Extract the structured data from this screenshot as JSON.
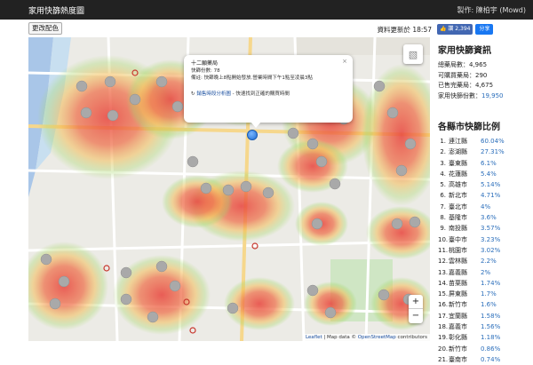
{
  "navbar": {
    "title": "家用快篩熱度圖",
    "credit": "製作: 陳柏宇 (Mowd)"
  },
  "toolbar": {
    "color_button": "更改配色",
    "updated_label": "資料更新於 18:57"
  },
  "popup": {
    "title": "十二願藥局",
    "stock": "快篩份數: 78",
    "note": "備註: 快篩晚上8點開始發放.營業時間下午1點至凌晨3點",
    "link_icon": "refresh-icon",
    "link_text": "銷售時段分析圖",
    "link_suffix": " - 快速找到正確的購買時間",
    "close": "×"
  },
  "map": {
    "layers_icon": "layers-icon",
    "zoom_in": "+",
    "zoom_out": "−",
    "attribution_leaflet": "Leaflet",
    "attribution_mid": " | Map data © ",
    "attribution_osm": "OpenStreetMap",
    "attribution_end": " contributors"
  },
  "social": {
    "like": "👍 讚 2,394",
    "share": "分享"
  },
  "info": {
    "title": "家用快篩資訊",
    "total": "總藥局數：4,965",
    "available": "可購買藥局：290",
    "sold_out": "已售完藥局：4,675",
    "stock_label": "家用快篩份數：",
    "stock_value": "19,950"
  },
  "ratio": {
    "title": "各縣市快篩比例",
    "rows": [
      {
        "rank": "1.",
        "name": "連江縣",
        "value": "60.04%"
      },
      {
        "rank": "2.",
        "name": "澎湖縣",
        "value": "27.31%"
      },
      {
        "rank": "3.",
        "name": "臺東縣",
        "value": "6.1%"
      },
      {
        "rank": "4.",
        "name": "花蓮縣",
        "value": "5.4%"
      },
      {
        "rank": "5.",
        "name": "高雄市",
        "value": "5.14%"
      },
      {
        "rank": "6.",
        "name": "新北市",
        "value": "4.71%"
      },
      {
        "rank": "7.",
        "name": "臺北市",
        "value": "4%"
      },
      {
        "rank": "8.",
        "name": "基隆市",
        "value": "3.6%"
      },
      {
        "rank": "9.",
        "name": "南投縣",
        "value": "3.57%"
      },
      {
        "rank": "10.",
        "name": "臺中市",
        "value": "3.23%"
      },
      {
        "rank": "11.",
        "name": "桃園市",
        "value": "3.02%"
      },
      {
        "rank": "12.",
        "name": "雲林縣",
        "value": "2.2%"
      },
      {
        "rank": "13.",
        "name": "嘉義縣",
        "value": "2%"
      },
      {
        "rank": "14.",
        "name": "苗栗縣",
        "value": "1.74%"
      },
      {
        "rank": "15.",
        "name": "屏東縣",
        "value": "1.7%"
      },
      {
        "rank": "16.",
        "name": "新竹市",
        "value": "1.6%"
      },
      {
        "rank": "17.",
        "name": "宜蘭縣",
        "value": "1.58%"
      },
      {
        "rank": "18.",
        "name": "嘉義市",
        "value": "1.56%"
      },
      {
        "rank": "19.",
        "name": "彰化縣",
        "value": "1.18%"
      },
      {
        "rank": "20.",
        "name": "新竹市",
        "value": "0.86%"
      },
      {
        "rank": "21.",
        "name": "臺南市",
        "value": "0.74%"
      }
    ]
  },
  "colors": {
    "navbar": "#222222",
    "link": "#2a6ebb",
    "facebook": "#4267b2",
    "heat_hot": "#e8433c",
    "heat_warm": "#f3b94a",
    "heat_cool": "#a8d86a"
  }
}
